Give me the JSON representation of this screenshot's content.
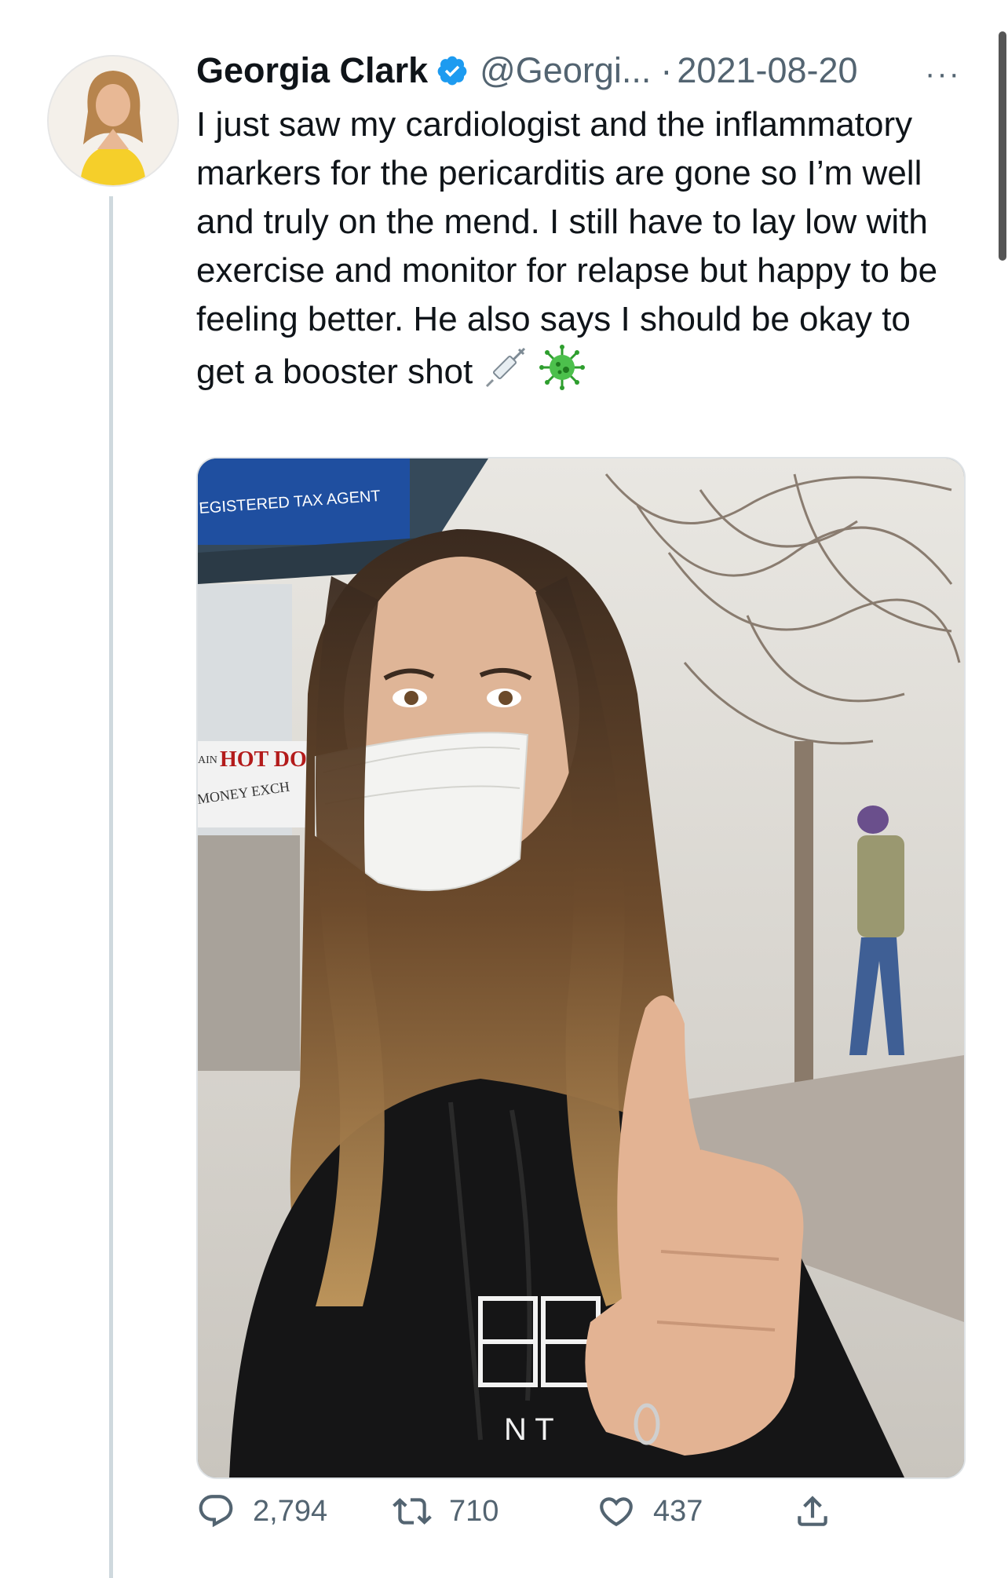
{
  "tweet": {
    "author": {
      "name": "Georgia Clark",
      "handle": "@Georgi...",
      "verified": true,
      "avatar_icon": "profile-photo"
    },
    "separator": "·",
    "date": "2021-08-20",
    "more_label": "···",
    "text": "I just saw my cardiologist and the inflammatory markers for the pericarditis are gone so I’m well and truly on the mend. I still have to lay low with exercise and monitor for relapse but happy to be feeling better. He also says I should be okay to get a booster shot",
    "emojis": [
      "syringe-icon",
      "virus-icon"
    ],
    "media": {
      "signs": {
        "tax_agent": "EGISTERED TAX AGENT",
        "hot_dog": "HOT DO",
        "main": "AIN",
        "money": "MONEY EXCH"
      },
      "sweatshirt_letters": "N T"
    },
    "actions": {
      "reply_count": "2,794",
      "retweet_count": "710",
      "like_count": "437"
    }
  },
  "colors": {
    "text": "#0f1419",
    "secondary": "#536471",
    "verified": "#1d9bf0",
    "thread_line": "#cfd9de"
  }
}
